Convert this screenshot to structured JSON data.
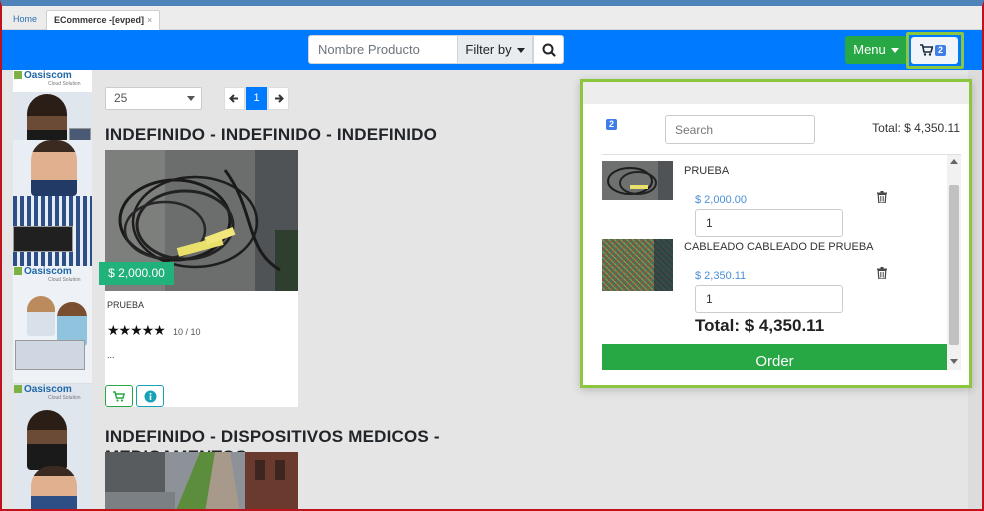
{
  "tabs": [
    {
      "label": "Home"
    },
    {
      "label": "ECommerce -[evped]",
      "close": "×"
    }
  ],
  "navbar": {
    "search_placeholder": "Nombre Producto",
    "filter_label": "Filter by",
    "search_icon": "search-icon",
    "menu_label": "Menu",
    "cart_icon": "cart-icon",
    "cart_count": "2"
  },
  "sidebar": {
    "brand": "Oasiscom",
    "brand_sub": "Cloud Solution"
  },
  "controls": {
    "page_size": "25",
    "current_page": "1"
  },
  "sections": [
    {
      "title": "INDEFINIDO - INDEFINIDO - INDEFINIDO",
      "product": {
        "price": "$ 2,000.00",
        "name": "PRUEBA",
        "stars": "★★★★★",
        "rating": "10 / 10",
        "description": "..."
      }
    },
    {
      "title": "INDEFINIDO - DISPOSITIVOS MEDICOS - MEDICAMENTOS"
    }
  ],
  "cart_dropdown": {
    "count": "2",
    "search_placeholder": "Search",
    "total_label": "Total: $ 4,350.11",
    "items": [
      {
        "name": "PRUEBA",
        "price": "$ 2,000.00",
        "quantity": "1"
      },
      {
        "name": "CABLEADO CABLEADO DE PRUEBA",
        "price": "$ 2,350.11",
        "quantity": "1"
      }
    ],
    "grand_total": "Total: $ 4,350.11",
    "order_label": "Order"
  },
  "colors": {
    "navbar": "#007bff",
    "success": "#28a745",
    "price_tag": "#20b27a",
    "highlight": "#8cc63e"
  }
}
